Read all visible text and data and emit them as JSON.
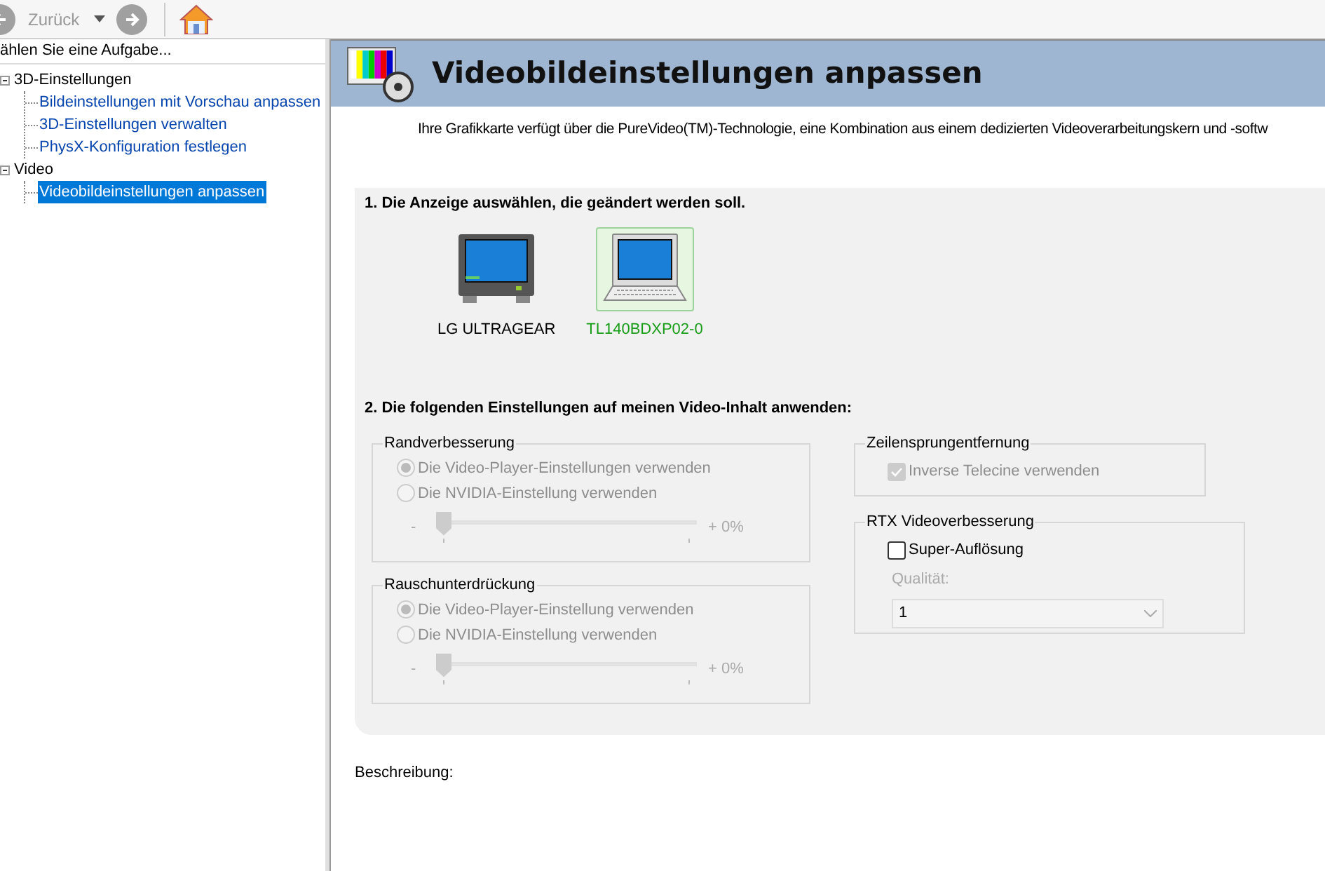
{
  "toolbar": {
    "back_label": "Zurück"
  },
  "sidebar": {
    "heading": "ählen Sie eine Aufgabe...",
    "tree": [
      {
        "label": "3D-Einstellungen",
        "expanded": true,
        "children": [
          {
            "label": "Bildeinstellungen mit Vorschau anpassen",
            "selected": false
          },
          {
            "label": "3D-Einstellungen verwalten",
            "selected": false
          },
          {
            "label": "PhysX-Konfiguration festlegen",
            "selected": false
          }
        ]
      },
      {
        "label": "Video",
        "expanded": true,
        "children": [
          {
            "label": "Videobildeinstellungen anpassen",
            "selected": true
          }
        ]
      }
    ]
  },
  "page": {
    "title": "Videobildeinstellungen anpassen",
    "intro": "Ihre Grafikkarte verfügt über die PureVideo(TM)-Technologie, eine Kombination aus einem dedizierten Videoverarbeitungskern und -softw",
    "step1": "1. Die Anzeige auswählen, die geändert werden soll.",
    "displays": [
      {
        "kind": "monitor",
        "label": "LG ULTRAGEAR",
        "selected": false
      },
      {
        "kind": "laptop",
        "label": "TL140BDXP02-0",
        "selected": true
      }
    ],
    "step2": "2. Die folgenden Einstellungen auf meinen Video-Inhalt anwenden:",
    "left_groups": [
      {
        "title": "Randverbesserung",
        "options": [
          {
            "label": "Die Video-Player-Einstellungen verwenden",
            "selected": true,
            "disabled": true
          },
          {
            "label": "Die NVIDIA-Einstellung verwenden",
            "selected": false,
            "disabled": true
          }
        ],
        "slider": {
          "min_label": "-",
          "max_label": "+ 0%",
          "level": 0,
          "disabled": true
        }
      },
      {
        "title": "Rauschunterdrückung",
        "options": [
          {
            "label": "Die Video-Player-Einstellung verwenden",
            "selected": true,
            "disabled": true
          },
          {
            "label": "Die NVIDIA-Einstellung verwenden",
            "selected": false,
            "disabled": true
          }
        ],
        "slider": {
          "min_label": "-",
          "max_label": "+ 0%",
          "level": 0,
          "disabled": true
        }
      }
    ],
    "deinterlace": {
      "title": "Zeilensprungentfernung",
      "checkbox": {
        "label": "Inverse Telecine verwenden",
        "checked": true,
        "disabled": true
      }
    },
    "rtx": {
      "title": "RTX Videoverbesserung",
      "checkbox": {
        "label": "Super-Auflösung",
        "checked": false,
        "disabled": false
      },
      "quality_label": "Qualität:",
      "quality_value": "1"
    },
    "description_label": "Beschreibung:"
  }
}
